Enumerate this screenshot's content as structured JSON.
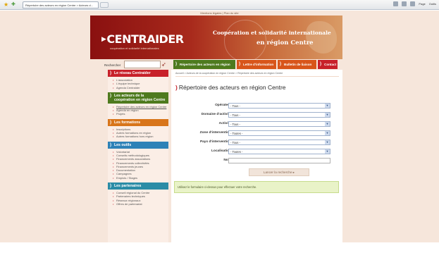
{
  "browser": {
    "tab_title": "Répertoire des acteurs en région Centre > Acteurs d...",
    "tools": [
      "Page",
      "Outils"
    ]
  },
  "top_links": "Mentions légales  |  Plan du site",
  "banner": {
    "logo_part1": "CENTR",
    "logo_part2": "AIDER",
    "logo_tagline": "coopération et solidarité internationales",
    "title_line1": "Coopération et solidarité internationale",
    "title_line2": "en région Centre"
  },
  "search": {
    "label": "Rechercher",
    "placeholder": ""
  },
  "nav": [
    {
      "label": "Répertoire des acteurs en région",
      "color": "#4e7a1e"
    },
    {
      "label": "Lettre d'information",
      "color": "#d8551a"
    },
    {
      "label": "Bulletin de liaison",
      "color": "#d8551a"
    },
    {
      "label": "Contact",
      "color": "#c8212a"
    }
  ],
  "sidebar": {
    "sections": [
      {
        "title": "Le réseau Centraider",
        "items": [
          "L'association",
          "L'équipe technique",
          "Agenda Centraider"
        ]
      },
      {
        "title": "Les acteurs de la coopération en région Centre",
        "items": [
          "Répertoire des acteurs en région Centre",
          "Agenda en région",
          "Projets"
        ]
      },
      {
        "title": "Les formations",
        "items": [
          "Inscriptions",
          "Autres formations en région",
          "Autres formations hors région"
        ]
      },
      {
        "title": "Les outils",
        "items": [
          "Volontariat",
          "Conseils méthodologiques",
          "Financements associations",
          "Financements collectivités",
          "Financements jeunes",
          "Documentation",
          "Campagnes",
          "Emplois / Stages"
        ]
      },
      {
        "title": "Les partenaires",
        "items": [
          "Conseil régional du Centre",
          "Partenaires techniques",
          "Réseaux régionaux",
          "Offres de partenariat"
        ]
      }
    ]
  },
  "main": {
    "breadcrumb": "Accueil > Acteurs de la coopération en région Centre > Répertoire des acteurs en région Centre",
    "title": "Répertoire des acteurs en région Centre",
    "form": {
      "operateur": {
        "label": "Opérateur",
        "value": "- Tous -"
      },
      "domaine": {
        "label": "Domaine d'activité",
        "value": "- Tous -"
      },
      "activite": {
        "label": "Activité",
        "value": "- Tous -"
      },
      "zone": {
        "label": "Zone d'intervention",
        "value": "- Toutes -"
      },
      "pays": {
        "label": "Pays d'intervention",
        "value": "- Tous -"
      },
      "localisation": {
        "label": "Localisation",
        "value": "- Toutes -"
      },
      "nom": {
        "label": "Nom",
        "value": ""
      }
    },
    "submit_label": "Lancer la recherche ▸",
    "info_text": "Utilisez le formulaire ci-dessus pour effectuer votre recherche."
  }
}
